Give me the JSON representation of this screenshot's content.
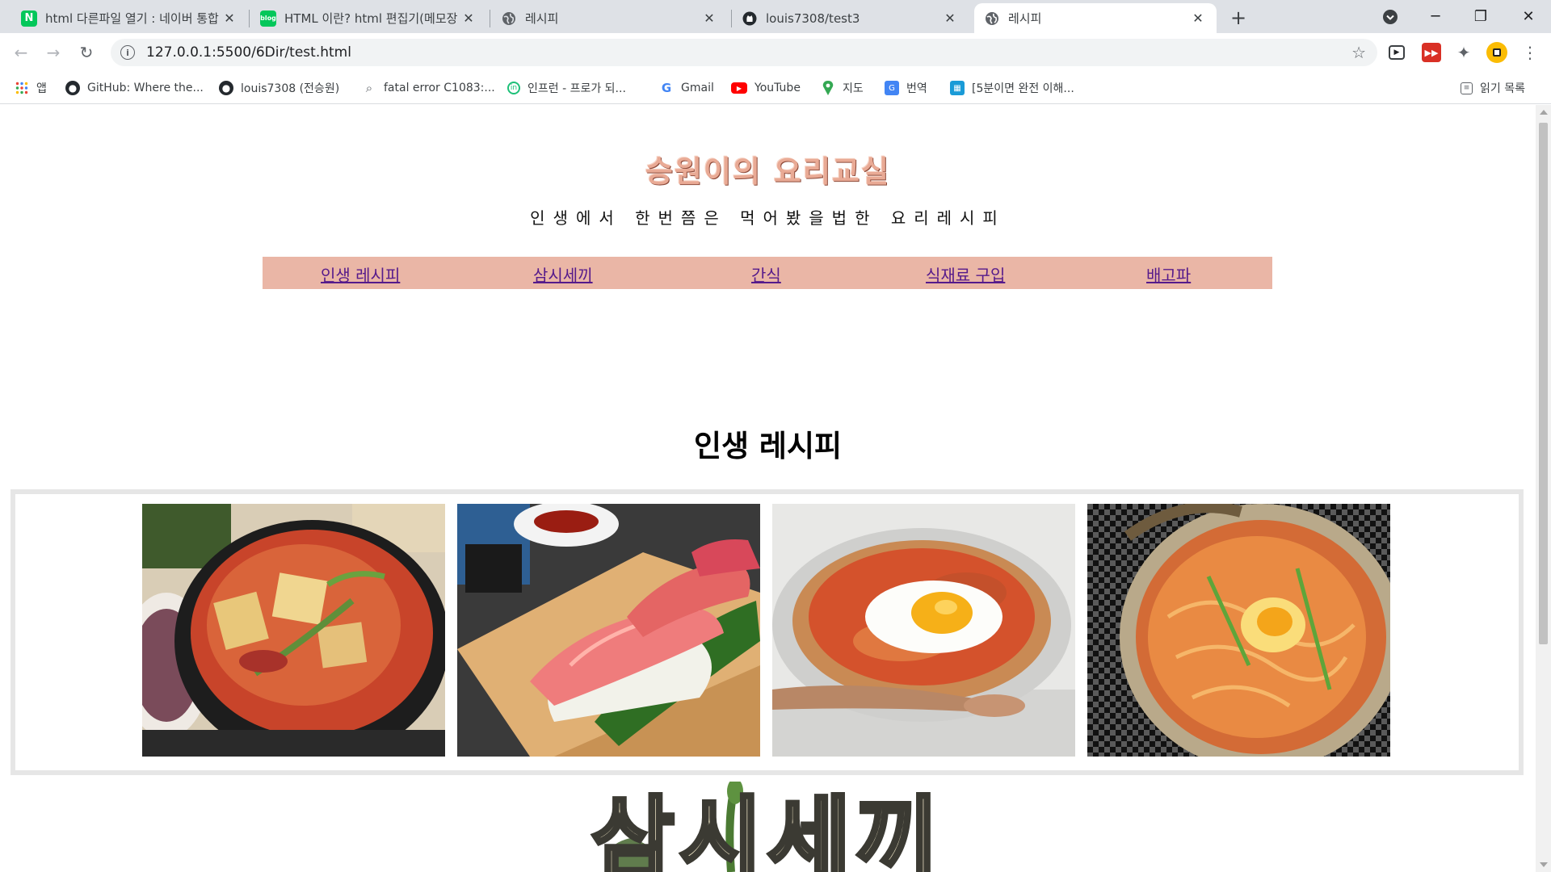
{
  "browser": {
    "tabs": [
      {
        "title": "html 다른파일 열기 : 네이버 통합",
        "icon": "naver-icon",
        "active": false
      },
      {
        "title": "HTML 이란? html 편집기(메모장",
        "icon": "naver-blog-icon",
        "active": false
      },
      {
        "title": "레시피",
        "icon": "globe-icon",
        "active": false
      },
      {
        "title": "louis7308/test3",
        "icon": "github-icon",
        "active": false
      },
      {
        "title": "레시피",
        "icon": "globe-icon",
        "active": true
      }
    ],
    "url": "127.0.0.1:5500/6Dir/test.html",
    "bookmarks": [
      {
        "label": "앱",
        "icon": "apps-grid-icon"
      },
      {
        "label": "GitHub: Where the...",
        "icon": "github-icon"
      },
      {
        "label": "louis7308 (전승원)",
        "icon": "github-icon"
      },
      {
        "label": "fatal error C1083:...",
        "icon": "search-page-icon"
      },
      {
        "label": "인프런 - 프로가 되...",
        "icon": "inflearn-icon"
      },
      {
        "label": "Gmail",
        "icon": "google-icon"
      },
      {
        "label": "YouTube",
        "icon": "youtube-icon"
      },
      {
        "label": "지도",
        "icon": "maps-pin-icon"
      },
      {
        "label": "번역",
        "icon": "translate-icon"
      },
      {
        "label": "[5분이면 완전 이해...",
        "icon": "bookmark-site-icon"
      }
    ],
    "reading_list": "읽기 목록"
  },
  "page": {
    "logo_text": "승원이의 요리교실",
    "tagline": "인생에서 한번쯤은 먹어봤을법한 요리레시피",
    "nav": [
      "인생 레시피",
      "삼시세끼",
      "간식",
      "식재료 구입",
      "배고파"
    ],
    "section_title": "인생 레시피",
    "photos": [
      {
        "name": "kimchi-stew-photo"
      },
      {
        "name": "tuna-sushi-photo"
      },
      {
        "name": "kimchi-fried-rice-photo"
      },
      {
        "name": "ramen-photo"
      }
    ],
    "samsi_logo_text": "삼시세끼"
  },
  "colors": {
    "nav_bg": "#eab6a6",
    "logo_color": "#e9aa95",
    "link_color": "#551a8b",
    "gallery_border": "#e6e6e6"
  }
}
